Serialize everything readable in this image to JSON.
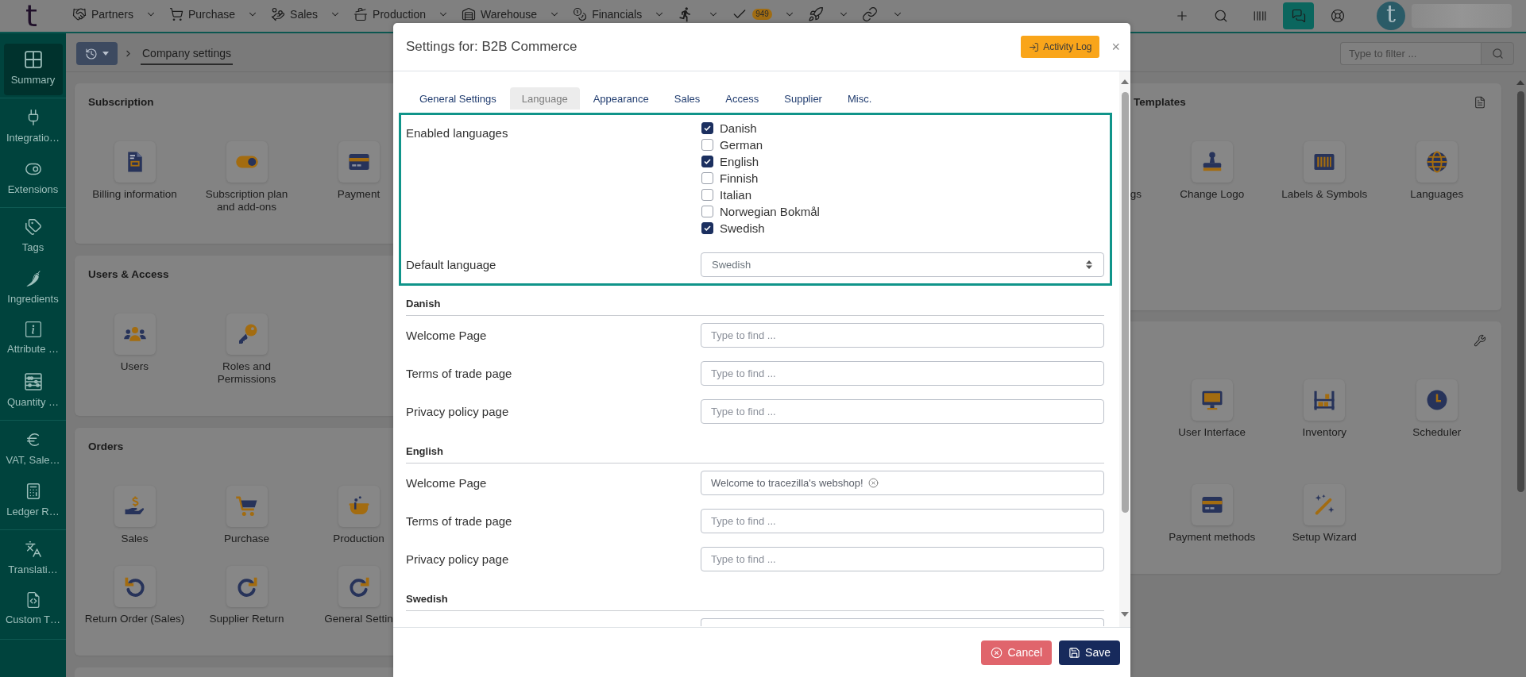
{
  "top_bar": {
    "logo": "t",
    "nav": [
      {
        "kind": "text",
        "label": "Partners"
      },
      {
        "kind": "text",
        "label": "Purchase"
      },
      {
        "kind": "text",
        "label": "Sales"
      },
      {
        "kind": "text",
        "label": "Production"
      },
      {
        "kind": "text",
        "label": "Warehouse"
      },
      {
        "kind": "text",
        "label": "Financials"
      },
      {
        "kind": "icon"
      },
      {
        "kind": "icon",
        "badge": "949"
      },
      {
        "kind": "icon"
      },
      {
        "kind": "icon"
      }
    ],
    "tools": [
      {
        "selected": false
      },
      {
        "selected": false
      },
      {
        "selected": false
      },
      {
        "selected": true
      },
      {
        "selected": false
      }
    ],
    "avatar": "t"
  },
  "sidebar": {
    "groups": [
      {
        "items": [
          {
            "label": "Summary",
            "selected": true
          }
        ]
      },
      {
        "items": [
          {
            "label": "Integratio…",
            "selected": false
          },
          {
            "label": "Extensions",
            "selected": false
          }
        ]
      },
      {
        "items": [
          {
            "label": "Tags",
            "selected": false
          },
          {
            "label": "Ingredients",
            "selected": false
          },
          {
            "label": "Attribute …",
            "selected": false
          },
          {
            "label": "Quantity …",
            "selected": false
          }
        ]
      },
      {
        "items": [
          {
            "label": "VAT, Sale…",
            "selected": false
          },
          {
            "label": "Ledger R…",
            "selected": false
          }
        ]
      },
      {
        "items": [
          {
            "label": "Translati…",
            "selected": false
          },
          {
            "label": "Custom T…",
            "selected": false
          }
        ]
      }
    ]
  },
  "breadcrumb": {
    "current": "Company settings"
  },
  "filter": {
    "placeholder": "Type to filter ..."
  },
  "cards": {
    "left": [
      {
        "title": "Subscription",
        "items": [
          {
            "kind": "tile",
            "label": "Billing information"
          },
          {
            "kind": "tile",
            "label": "Subscription plan and add-ons"
          },
          {
            "kind": "tile",
            "label": "Payment"
          }
        ]
      },
      {
        "title": "Users & Access",
        "items": [
          {
            "kind": "tile",
            "label": "Users"
          },
          {
            "kind": "tile",
            "label": "Roles and Permissions"
          }
        ]
      },
      {
        "title": "Orders",
        "items": [
          {
            "kind": "tile",
            "label": "Sales"
          },
          {
            "kind": "tile",
            "label": "Purchase"
          },
          {
            "kind": "tile",
            "label": "Production"
          },
          {
            "kind": "tile",
            "label": "Return Order (Sales)"
          },
          {
            "kind": "tile",
            "label": "Supplier Return"
          },
          {
            "kind": "tile",
            "label": "General Settin"
          }
        ]
      }
    ],
    "right": [
      {
        "title": "Templates",
        "items": [
          {
            "kind": "cut",
            "label": "gs"
          },
          {
            "kind": "tile",
            "label": "Change Logo"
          },
          {
            "kind": "tile",
            "label": "Labels & Symbols"
          },
          {
            "kind": "tile",
            "label": "Languages"
          }
        ]
      },
      {
        "items": [
          {
            "kind": "tile",
            "label": "User Interface"
          },
          {
            "kind": "tile",
            "label": "Inventory"
          },
          {
            "kind": "tile",
            "label": "Scheduler"
          },
          {
            "kind": "tile",
            "label": "Payment methods"
          },
          {
            "kind": "tile",
            "label": "Setup Wizard"
          }
        ]
      }
    ]
  },
  "modal": {
    "title": "Settings for: B2B Commerce",
    "activity_log": "Activity Log",
    "close": "×",
    "tabs": [
      {
        "label": "General Settings",
        "selected": false
      },
      {
        "label": "Language",
        "selected": true
      },
      {
        "label": "Appearance",
        "selected": false
      },
      {
        "label": "Sales",
        "selected": false
      },
      {
        "label": "Access",
        "selected": false
      },
      {
        "label": "Supplier",
        "selected": false
      },
      {
        "label": "Misc.",
        "selected": false
      }
    ],
    "language_settings": {
      "highlighted": true,
      "enabled_label": "Enabled languages",
      "options": [
        {
          "label": "Danish",
          "checked": true
        },
        {
          "label": "German",
          "checked": false
        },
        {
          "label": "English",
          "checked": true
        },
        {
          "label": "Finnish",
          "checked": false
        },
        {
          "label": "Italian",
          "checked": false
        },
        {
          "label": "Norwegian Bokmål",
          "checked": false
        },
        {
          "label": "Swedish",
          "checked": true
        }
      ],
      "default_label": "Default language",
      "default_value": "Swedish"
    },
    "sections": [
      {
        "title": "Danish",
        "fields": [
          {
            "label": "Welcome Page",
            "placeholder": "Type to find ..."
          },
          {
            "label": "Terms of trade page",
            "placeholder": "Type to find ..."
          },
          {
            "label": "Privacy policy page",
            "placeholder": "Type to find ..."
          }
        ]
      },
      {
        "title": "English",
        "fields": [
          {
            "label": "Welcome Page",
            "value": "Welcome to tracezilla's webshop!"
          },
          {
            "label": "Terms of trade page",
            "placeholder": "Type to find ..."
          },
          {
            "label": "Privacy policy page",
            "placeholder": "Type to find ..."
          }
        ]
      },
      {
        "title": "Swedish",
        "cut_off": true
      }
    ],
    "footer": {
      "cancel": "Cancel",
      "save": "Save"
    }
  }
}
